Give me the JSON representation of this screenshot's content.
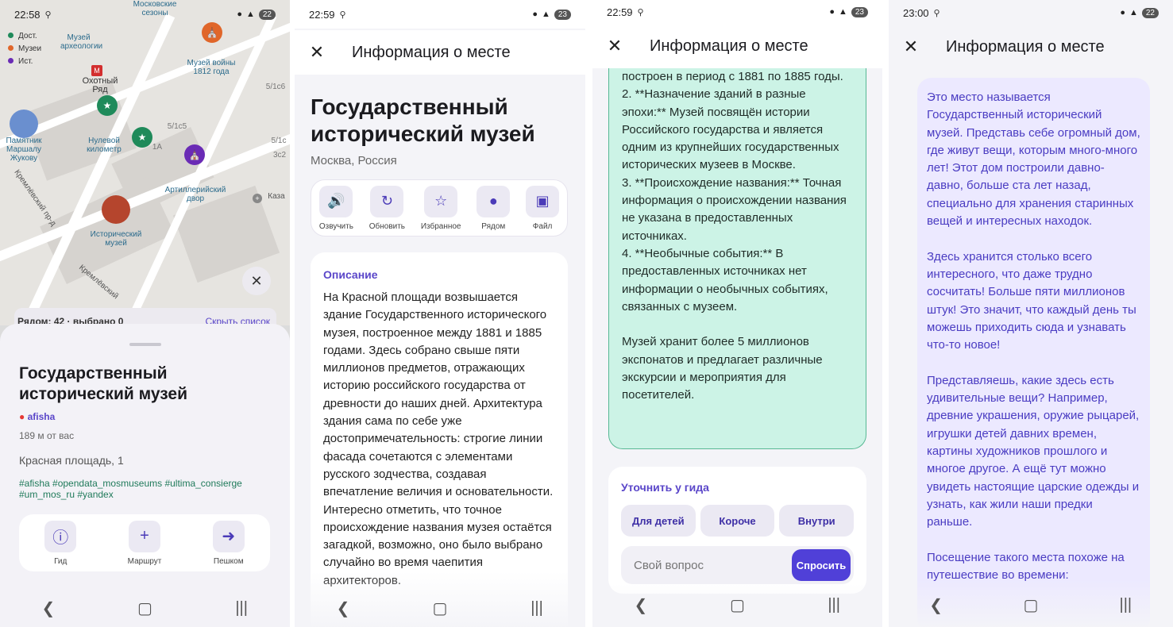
{
  "screen1": {
    "time": "22:58",
    "map_labels": {
      "seasons": "Московские сезоны",
      "museum_arch": "Музей археологии",
      "okhotny": "Охотный Ряд",
      "museum_1812": "Музей войны 1812 года",
      "zero_km": "Нулевой километр",
      "marshal": "Памятник Маршалу Жукову",
      "artillery": "Артиллерийский двор",
      "historical": "Исторический музей",
      "kremlin1": "Кремлёвский пр-д",
      "kremlin2": "Кремлёвский",
      "kaz": "Каза",
      "h1": "5/1с6",
      "h2": "5/1с5",
      "h3": "1А",
      "h4": "5/1с",
      "h5": "3с2"
    },
    "legend": [
      "Дост.",
      "Музеи",
      "Ист."
    ],
    "nearby_bar": "Рядом: 42 · выбрано 0",
    "hide_list": "Скрыть список",
    "title": "Государственный исторический музей",
    "source": "afisha",
    "distance": "189 м от вас",
    "address": "Красная площадь, 1",
    "tags": "#afisha #opendata_mosmuseums #ultima_consierge #um_mos_ru #yandex",
    "actions": [
      "Гид",
      "Маршрут",
      "Пешком"
    ]
  },
  "screen2": {
    "time": "22:59",
    "battery": "23",
    "appbar_title": "Информация о месте",
    "title": "Государственный исторический музей",
    "location": "Москва, Россия",
    "actions": [
      "Озвучить",
      "Обновить",
      "Избранное",
      "Рядом",
      "Файл"
    ],
    "desc_label": "Описание",
    "desc_text": "На Красной площади возвышается здание Государственного исторического музея, построенное между 1881 и 1885 годами. Здесь собрано свыше пяти миллионов предметов, отражающих историю российского государства от древности до наших дней. Архитектура здания сама по себе уже достопримечательность: строгие линии фасада сочетаются с элементами русского зодчества, создавая впечатление величия и основательности. Интересно отметить, что точное происхождение названия музея остаётся загадкой, возможно, оно было выбрано случайно во время чаепития архитекторов."
  },
  "screen3": {
    "time": "22:59",
    "battery": "23",
    "appbar_title": "Информация о месте",
    "answer_text": "построен в период с 1881 по 1885 годы.\n2. **Назначение зданий в разные эпохи:** Музей посвящён истории Российского государства и является одним из крупнейших государственных исторических музеев в Москве.\n3. **Происхождение названия:** Точная информация о происхождении названия не указана в предоставленных источниках.\n4. **Необычные события:** В предоставленных источниках нет информации о необычных событиях, связанных с музеем.\n\nМузей хранит более 5 миллионов экспонатов и предлагает различные экскурсии и мероприятия для посетителей.",
    "guide_label": "Уточнить у гида",
    "chips": [
      "Для детей",
      "Короче",
      "Внутри"
    ],
    "question_placeholder": "Свой вопрос",
    "ask_button": "Спросить"
  },
  "screen4": {
    "time": "23:00",
    "battery": "22",
    "appbar_title": "Информация о месте",
    "kids_text": "Это место называется Государственный исторический музей. Представь себе огромный дом, где живут вещи, которым много-много лет! Этот дом построили давно-давно, больше ста лет назад, специально для хранения старинных вещей и интересных находок.\n\nЗдесь хранится столько всего интересного, что даже трудно сосчитать! Больше пяти миллионов штук! Это значит, что каждый день ты можешь приходить сюда и узнавать что-то новое!\n\nПредставляешь, какие здесь есть удивительные вещи? Например, древние украшения, оружие рыцарей, игрушки детей давних времен, картины художников прошлого и многое другое. А ещё тут можно увидеть настоящие царские одежды и узнать, как жили наши предки раньше.\n\nПосещение такого места похоже на путешествие во времени:"
  },
  "colors": {
    "accent": "#5040d8",
    "green_card": "#ccf3e6",
    "purple_card": "#ece9ff",
    "pin_green": "#1f8a5a",
    "pin_orange": "#e0662a",
    "pin_purple": "#6a2bb5"
  }
}
